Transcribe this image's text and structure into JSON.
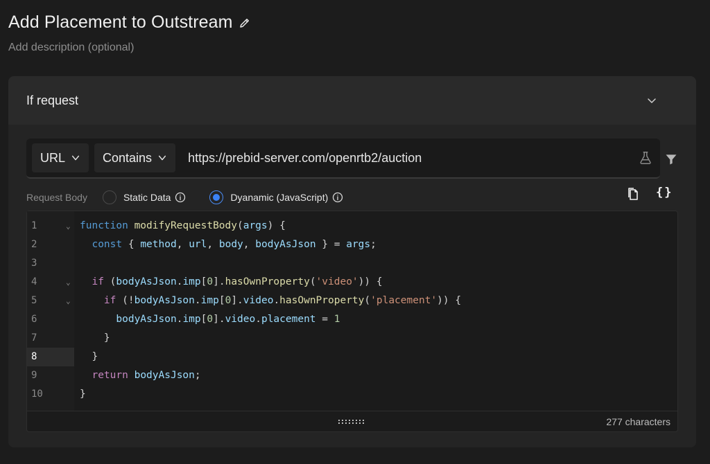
{
  "header": {
    "title": "Add Placement to Outstream",
    "description": "Add description (optional)"
  },
  "card": {
    "title": "If request"
  },
  "url_row": {
    "key_select": "URL",
    "operator_select": "Contains",
    "value": "https://prebid-server.com/openrtb2/auction"
  },
  "request_body": {
    "label": "Request Body",
    "options": [
      {
        "label": "Static Data",
        "selected": false
      },
      {
        "label": "Dyanamic (JavaScript)",
        "selected": true
      }
    ]
  },
  "editor": {
    "active_line": 8,
    "char_count": "277 characters",
    "lines": [
      {
        "n": "1",
        "fold": true
      },
      {
        "n": "2",
        "fold": false
      },
      {
        "n": "3",
        "fold": false
      },
      {
        "n": "4",
        "fold": true
      },
      {
        "n": "5",
        "fold": true
      },
      {
        "n": "6",
        "fold": false
      },
      {
        "n": "7",
        "fold": false
      },
      {
        "n": "8",
        "fold": false
      },
      {
        "n": "9",
        "fold": false
      },
      {
        "n": "10",
        "fold": false
      }
    ]
  },
  "colors": {
    "accent": "#3b82f6",
    "background": "#1c1c1c",
    "card": "#242424"
  },
  "icons": [
    "pencil-icon",
    "chevron-down-icon",
    "flask-icon",
    "filter-icon",
    "info-icon",
    "copy-icon",
    "braces-icon",
    "resize-grip-icon"
  ]
}
